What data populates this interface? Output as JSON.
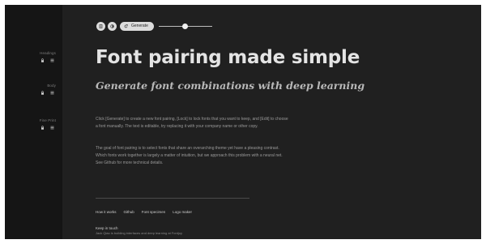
{
  "sidebar": {
    "groups": [
      {
        "label": "Headings"
      },
      {
        "label": "Body"
      },
      {
        "label": "Fine Print"
      }
    ]
  },
  "toolbar": {
    "generate_label": "Generate",
    "slider_value": 0.5
  },
  "hero": {
    "title": "Font pairing made simple",
    "subtitle": "Generate font combinations with deep learning"
  },
  "content": {
    "paragraph_1": "Click [Generate] to create a new font pairing, [Lock] to lock fonts that you want to keep, and [Edit] to choose a font manually. The text is editable, try replacing it with your company name or other copy.",
    "paragraph_2": "The goal of font pairing is to select fonts that share an overarching theme yet have a pleasing contrast. Which fonts work together is largely a matter of intuition, but we approach this problem with a neural net. See Github for more technical details."
  },
  "footer": {
    "links": [
      "How it works",
      "Github",
      "Font specimen",
      "Logo maker"
    ],
    "contact_title": "Keep in touch",
    "contact_text": "Jack Qiao is building interfaces and deep learning at Fontjoy"
  },
  "colors": {
    "background": "#202020",
    "sidebar": "#151515",
    "headline": "#e4e4e4",
    "button": "#dcdcdc"
  }
}
